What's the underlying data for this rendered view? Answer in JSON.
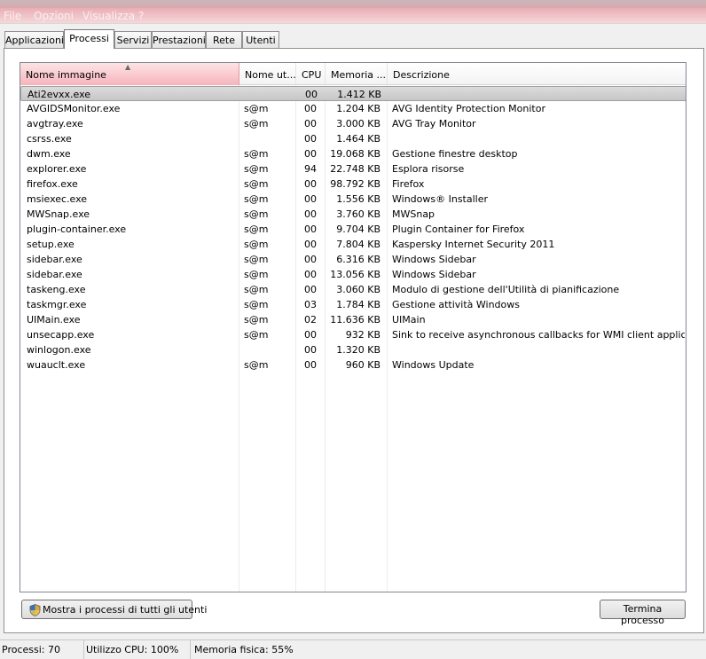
{
  "menubar": {
    "items": [
      "File",
      "Opzioni",
      "Visualizza",
      "?"
    ]
  },
  "tabs": [
    {
      "label": "Applicazioni"
    },
    {
      "label": "Processi"
    },
    {
      "label": "Servizi"
    },
    {
      "label": "Prestazioni"
    },
    {
      "label": "Rete"
    },
    {
      "label": "Utenti"
    }
  ],
  "active_tab": "Processi",
  "table": {
    "columns": {
      "name": "Nome immagine",
      "user": "Nome ut...",
      "cpu": "CPU",
      "mem": "Memoria ...",
      "desc": "Descrizione"
    },
    "rows": [
      {
        "name": "Ati2evxx.exe",
        "user": "",
        "cpu": "00",
        "mem": "1.412 KB",
        "desc": ""
      },
      {
        "name": "AVGIDSMonitor.exe",
        "user": "s@m",
        "cpu": "00",
        "mem": "1.204 KB",
        "desc": "AVG Identity Protection Monitor"
      },
      {
        "name": "avgtray.exe",
        "user": "s@m",
        "cpu": "00",
        "mem": "3.000 KB",
        "desc": "AVG Tray Monitor"
      },
      {
        "name": "csrss.exe",
        "user": "",
        "cpu": "00",
        "mem": "1.464 KB",
        "desc": ""
      },
      {
        "name": "dwm.exe",
        "user": "s@m",
        "cpu": "00",
        "mem": "19.068 KB",
        "desc": "Gestione finestre desktop"
      },
      {
        "name": "explorer.exe",
        "user": "s@m",
        "cpu": "94",
        "mem": "22.748 KB",
        "desc": "Esplora risorse"
      },
      {
        "name": "firefox.exe",
        "user": "s@m",
        "cpu": "00",
        "mem": "98.792 KB",
        "desc": "Firefox"
      },
      {
        "name": "msiexec.exe",
        "user": "s@m",
        "cpu": "00",
        "mem": "1.556 KB",
        "desc": "Windows® Installer"
      },
      {
        "name": "MWSnap.exe",
        "user": "s@m",
        "cpu": "00",
        "mem": "3.760 KB",
        "desc": "MWSnap"
      },
      {
        "name": "plugin-container.exe",
        "user": "s@m",
        "cpu": "00",
        "mem": "9.704 KB",
        "desc": "Plugin Container for Firefox"
      },
      {
        "name": "setup.exe",
        "user": "s@m",
        "cpu": "00",
        "mem": "7.804 KB",
        "desc": "Kaspersky Internet Security 2011"
      },
      {
        "name": "sidebar.exe",
        "user": "s@m",
        "cpu": "00",
        "mem": "6.316 KB",
        "desc": "Windows Sidebar"
      },
      {
        "name": "sidebar.exe",
        "user": "s@m",
        "cpu": "00",
        "mem": "13.056 KB",
        "desc": "Windows Sidebar"
      },
      {
        "name": "taskeng.exe",
        "user": "s@m",
        "cpu": "00",
        "mem": "3.060 KB",
        "desc": "Modulo di gestione dell'Utilità di pianificazione"
      },
      {
        "name": "taskmgr.exe",
        "user": "s@m",
        "cpu": "03",
        "mem": "1.784 KB",
        "desc": "Gestione attività Windows"
      },
      {
        "name": "UIMain.exe",
        "user": "s@m",
        "cpu": "02",
        "mem": "11.636 KB",
        "desc": "UIMain"
      },
      {
        "name": "unsecapp.exe",
        "user": "s@m",
        "cpu": "00",
        "mem": "932 KB",
        "desc": "Sink to receive asynchronous callbacks for WMI client application"
      },
      {
        "name": "winlogon.exe",
        "user": "",
        "cpu": "00",
        "mem": "1.320 KB",
        "desc": ""
      },
      {
        "name": "wuauclt.exe",
        "user": "s@m",
        "cpu": "00",
        "mem": "960 KB",
        "desc": "Windows Update"
      }
    ]
  },
  "buttons": {
    "show_all": "Mostra i processi di tutti gli utenti",
    "end_process": "Termina processo"
  },
  "status": {
    "processes": "Processi: 70",
    "cpu": "Utilizzo CPU: 100%",
    "memory": "Memoria fisica: 55%"
  },
  "colors": {
    "sorted_header": "#f5b4bb",
    "selected_row": "#c6c6c6",
    "menubar": "#e9aeb4"
  }
}
